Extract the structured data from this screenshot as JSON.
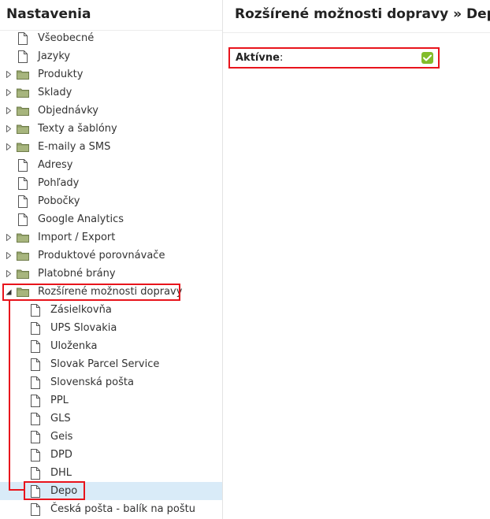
{
  "sidebar": {
    "title": "Nastavenia",
    "items": [
      {
        "label": "Všeobecné",
        "type": "file",
        "level": 0
      },
      {
        "label": "Jazyky",
        "type": "file",
        "level": 0
      },
      {
        "label": "Produkty",
        "type": "folder",
        "level": 0,
        "expanded": false
      },
      {
        "label": "Sklady",
        "type": "folder",
        "level": 0,
        "expanded": false
      },
      {
        "label": "Objednávky",
        "type": "folder",
        "level": 0,
        "expanded": false
      },
      {
        "label": "Texty a šablóny",
        "type": "folder",
        "level": 0,
        "expanded": false
      },
      {
        "label": "E-maily a SMS",
        "type": "folder",
        "level": 0,
        "expanded": false
      },
      {
        "label": "Adresy",
        "type": "file",
        "level": 0
      },
      {
        "label": "Pohľady",
        "type": "file",
        "level": 0
      },
      {
        "label": "Pobočky",
        "type": "file",
        "level": 0
      },
      {
        "label": "Google Analytics",
        "type": "file",
        "level": 0
      },
      {
        "label": "Import / Export",
        "type": "folder",
        "level": 0,
        "expanded": false
      },
      {
        "label": "Produktové porovnávače",
        "type": "folder",
        "level": 0,
        "expanded": false
      },
      {
        "label": "Platobné brány",
        "type": "folder",
        "level": 0,
        "expanded": false
      },
      {
        "label": "Rozšírené možnosti dopravy",
        "type": "folder",
        "level": 0,
        "expanded": true
      },
      {
        "label": "Zásielkovňa",
        "type": "file",
        "level": 1
      },
      {
        "label": "UPS Slovakia",
        "type": "file",
        "level": 1
      },
      {
        "label": "Uloženka",
        "type": "file",
        "level": 1
      },
      {
        "label": "Slovak Parcel Service",
        "type": "file",
        "level": 1
      },
      {
        "label": "Slovenská pošta",
        "type": "file",
        "level": 1
      },
      {
        "label": "PPL",
        "type": "file",
        "level": 1
      },
      {
        "label": "GLS",
        "type": "file",
        "level": 1
      },
      {
        "label": "Geis",
        "type": "file",
        "level": 1
      },
      {
        "label": "DPD",
        "type": "file",
        "level": 1
      },
      {
        "label": "DHL",
        "type": "file",
        "level": 1
      },
      {
        "label": "Depo",
        "type": "file",
        "level": 1,
        "selected": true
      },
      {
        "label": "Česká pošta - balík na poštu",
        "type": "file",
        "level": 1
      }
    ]
  },
  "main": {
    "title": "Rozšírené možnosti dopravy » Depo",
    "field": {
      "label": "Aktívne",
      "suffix": ":",
      "checked": true
    }
  },
  "colors": {
    "highlight": "#e8141c",
    "selected_row": "#d9ebf8",
    "checkbox": "#82bc2a",
    "folder": "#94a36c"
  },
  "icons": {
    "file": "file-icon",
    "folder": "folder-icon",
    "collapsed": "triangle-right-icon",
    "expanded": "triangle-down-icon",
    "check": "check-icon"
  }
}
